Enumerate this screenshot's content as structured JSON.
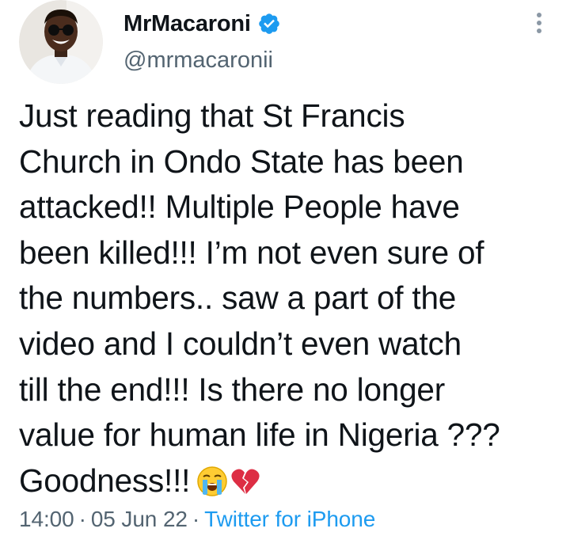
{
  "author": {
    "display_name": "MrMacaroni",
    "handle": "@mrmacaronii",
    "verified": true
  },
  "icons": {
    "verified": "verified-badge-icon",
    "more": "more-options-icon",
    "crying_face": "loudly-crying-face-emoji",
    "broken_heart": "broken-heart-emoji"
  },
  "tweet": {
    "lines": [
      "Just reading that St Francis",
      "Church in Ondo State has been",
      "attacked!! Multiple People have",
      "been killed!!! I’m not even sure of",
      "the numbers.. saw a part of the",
      "video and I couldn’t even watch",
      "till the end!!! Is there no longer",
      "value for human life in Nigeria ???",
      "Goodness!!!"
    ]
  },
  "meta": {
    "time": "14:00",
    "separator": "·",
    "date": "05 Jun 22",
    "source": "Twitter for iPhone"
  },
  "colors": {
    "text": "#0f1419",
    "secondary": "#536471",
    "link": "#1d9bf0",
    "verified": "#1d9bf0"
  }
}
